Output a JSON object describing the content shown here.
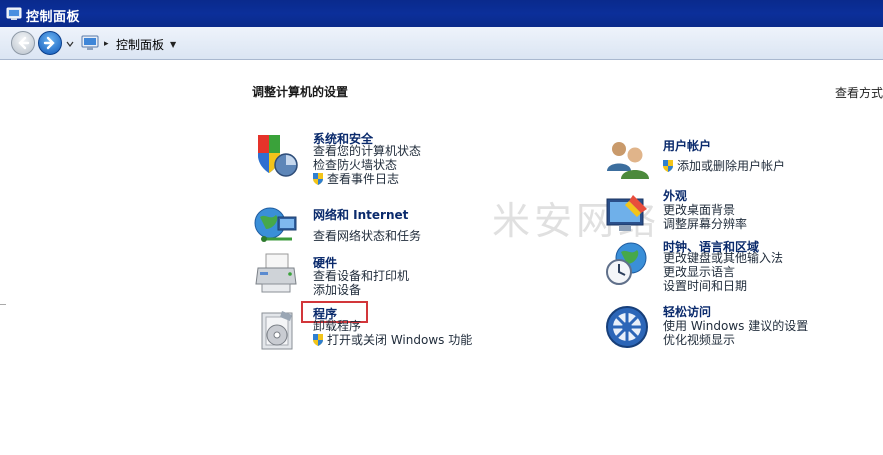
{
  "window": {
    "title": "控制面板"
  },
  "nav": {
    "back_icon": "back-arrow-icon",
    "forward_icon": "forward-arrow-icon",
    "address": {
      "breadcrumb": "控制面板"
    }
  },
  "page": {
    "heading": "调整计算机的设置",
    "view_by": "查看方式"
  },
  "categories": [
    {
      "title": "系统和安全",
      "icon": "system-security-icon",
      "links": [
        {
          "text": "查看您的计算机状态",
          "shield": false
        },
        {
          "text": "检查防火墙状态",
          "shield": false
        },
        {
          "text": "查看事件日志",
          "shield": true
        }
      ]
    },
    {
      "title": "网络和 Internet",
      "icon": "network-internet-icon",
      "links": [
        {
          "text": "查看网络状态和任务",
          "shield": false
        }
      ]
    },
    {
      "title": "硬件",
      "icon": "hardware-printer-icon",
      "links": [
        {
          "text": "查看设备和打印机",
          "shield": false
        },
        {
          "text": "添加设备",
          "shield": false
        }
      ]
    },
    {
      "title": "程序",
      "icon": "programs-icon",
      "highlighted": true,
      "links": [
        {
          "text": "卸载程序",
          "shield": false
        },
        {
          "text": "打开或关闭 Windows 功能",
          "shield": true
        }
      ]
    },
    {
      "title": "用户帐户",
      "icon": "user-accounts-icon",
      "links": [
        {
          "text": "添加或删除用户帐户",
          "shield": true
        }
      ]
    },
    {
      "title": "外观",
      "icon": "appearance-icon",
      "links": [
        {
          "text": "更改桌面背景",
          "shield": false
        },
        {
          "text": "调整屏幕分辨率",
          "shield": false
        }
      ]
    },
    {
      "title": "时钟、语言和区域",
      "icon": "clock-language-region-icon",
      "links": [
        {
          "text": "更改键盘或其他输入法",
          "shield": false
        },
        {
          "text": "更改显示语言",
          "shield": false
        },
        {
          "text": "设置时间和日期",
          "shield": false
        }
      ]
    },
    {
      "title": "轻松访问",
      "icon": "ease-of-access-icon",
      "links": [
        {
          "text": "使用 Windows 建议的设置",
          "shield": false
        },
        {
          "text": "优化视频显示",
          "shield": false
        }
      ]
    }
  ],
  "watermark": "米安网络",
  "colors": {
    "title_bar": "#0b2f9a",
    "link_title": "#0a2a6c",
    "highlight": "#d2363a"
  }
}
